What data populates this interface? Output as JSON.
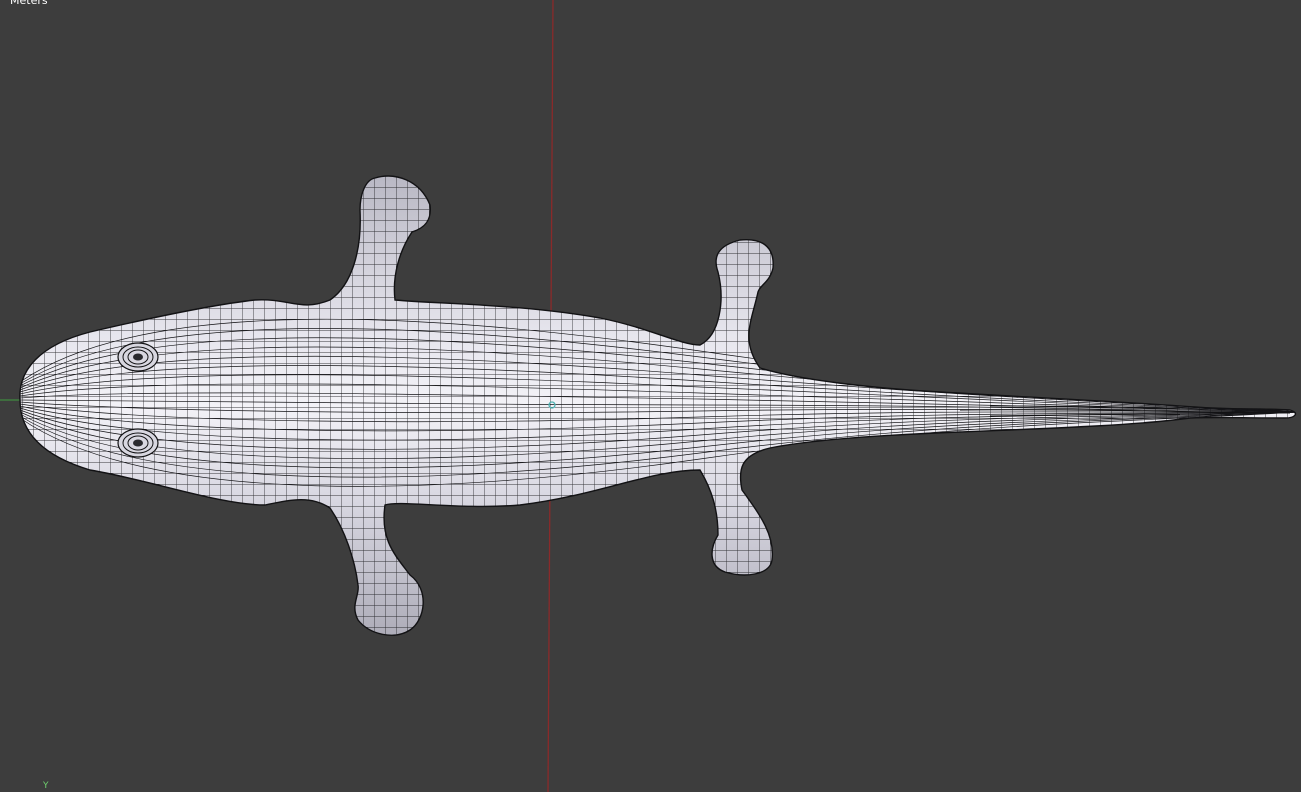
{
  "viewport": {
    "unit_label": "Meters",
    "axis_indicator_label": "Y",
    "background_color": "#3d3d3d",
    "mesh_fill_color": "#e4e3ec",
    "mesh_wire_color": "#121214",
    "y_axis_line_color": "#8a2a2a",
    "x_axis_line_color": "#3f8a3f",
    "object_origin_color": "#4fb3b3",
    "object": "lizard-mesh-top-view",
    "shading": "solid-with-wireframe"
  }
}
